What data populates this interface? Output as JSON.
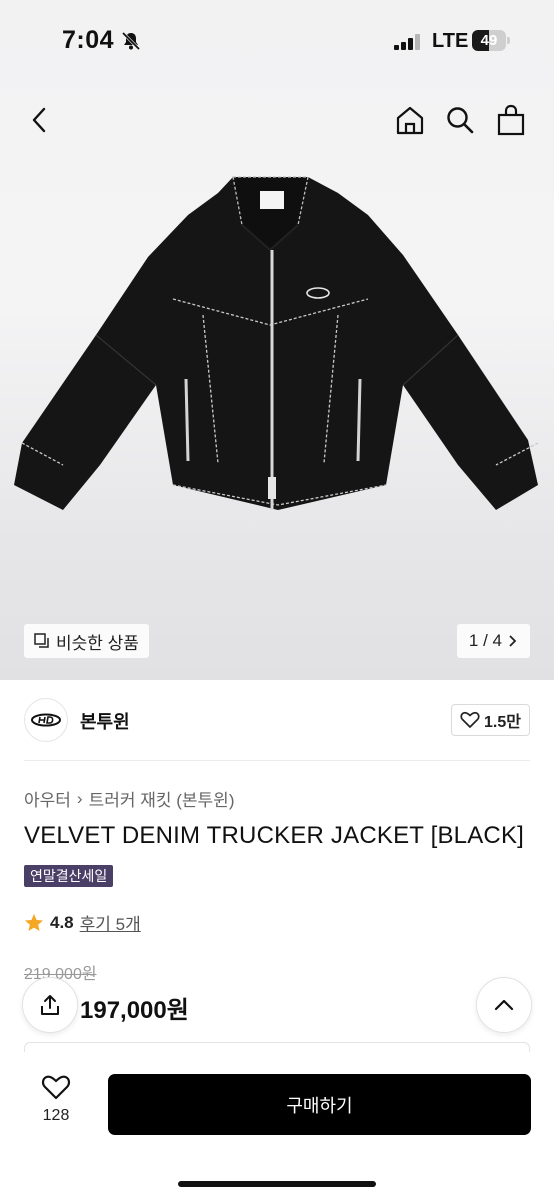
{
  "status_bar": {
    "time": "7:04",
    "network": "LTE",
    "battery": "49",
    "battery_level": 0.49
  },
  "top_nav": {
    "back_icon": "chevron-left-icon",
    "home_icon": "home-icon",
    "search_icon": "search-icon",
    "cart_icon": "shopping-bag-icon"
  },
  "gallery": {
    "similar_label": "비슷한 상품",
    "page_indicator": "1 / 4"
  },
  "brand": {
    "name": "본투윈",
    "like_count": "1.5만"
  },
  "product": {
    "breadcrumb": [
      "아우터",
      "트러커 재킷 (본투윈)"
    ],
    "title": "VELVET DENIM TRUCKER JACKET [BLACK]",
    "sale_badge": "연말결산세일",
    "rating": "4.8",
    "reviews": "후기 5개",
    "original_price": "219,000원",
    "price": "197,000원"
  },
  "bottom_bar": {
    "wish_count": "128",
    "buy_label": "구매하기"
  },
  "colors": {
    "badge": "#4a3f66",
    "star": "#f5a623",
    "buy_button": "#000000"
  }
}
